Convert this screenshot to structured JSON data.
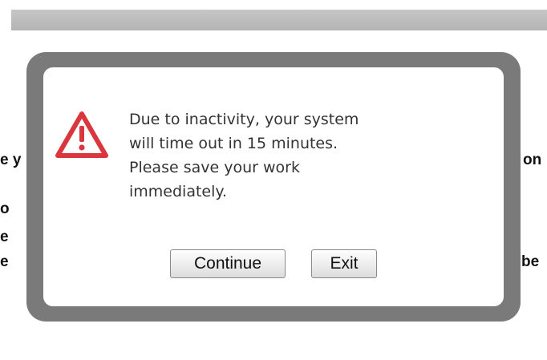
{
  "background": {
    "fragments_left": [
      "e y",
      "o",
      "e",
      "e"
    ],
    "fragments_right": [
      "on",
      "be"
    ]
  },
  "dialog": {
    "icon": "warning-triangle-icon",
    "message_lines": [
      "Due to inactivity, your system",
      "will time out in 15 minutes.",
      "Please save your work",
      "immediately."
    ],
    "continue_label": "Continue",
    "exit_label": "Exit"
  },
  "colors": {
    "frame": "#7a7a7a",
    "icon_red": "#d9363e",
    "top_bar": "#bdbdbd"
  }
}
